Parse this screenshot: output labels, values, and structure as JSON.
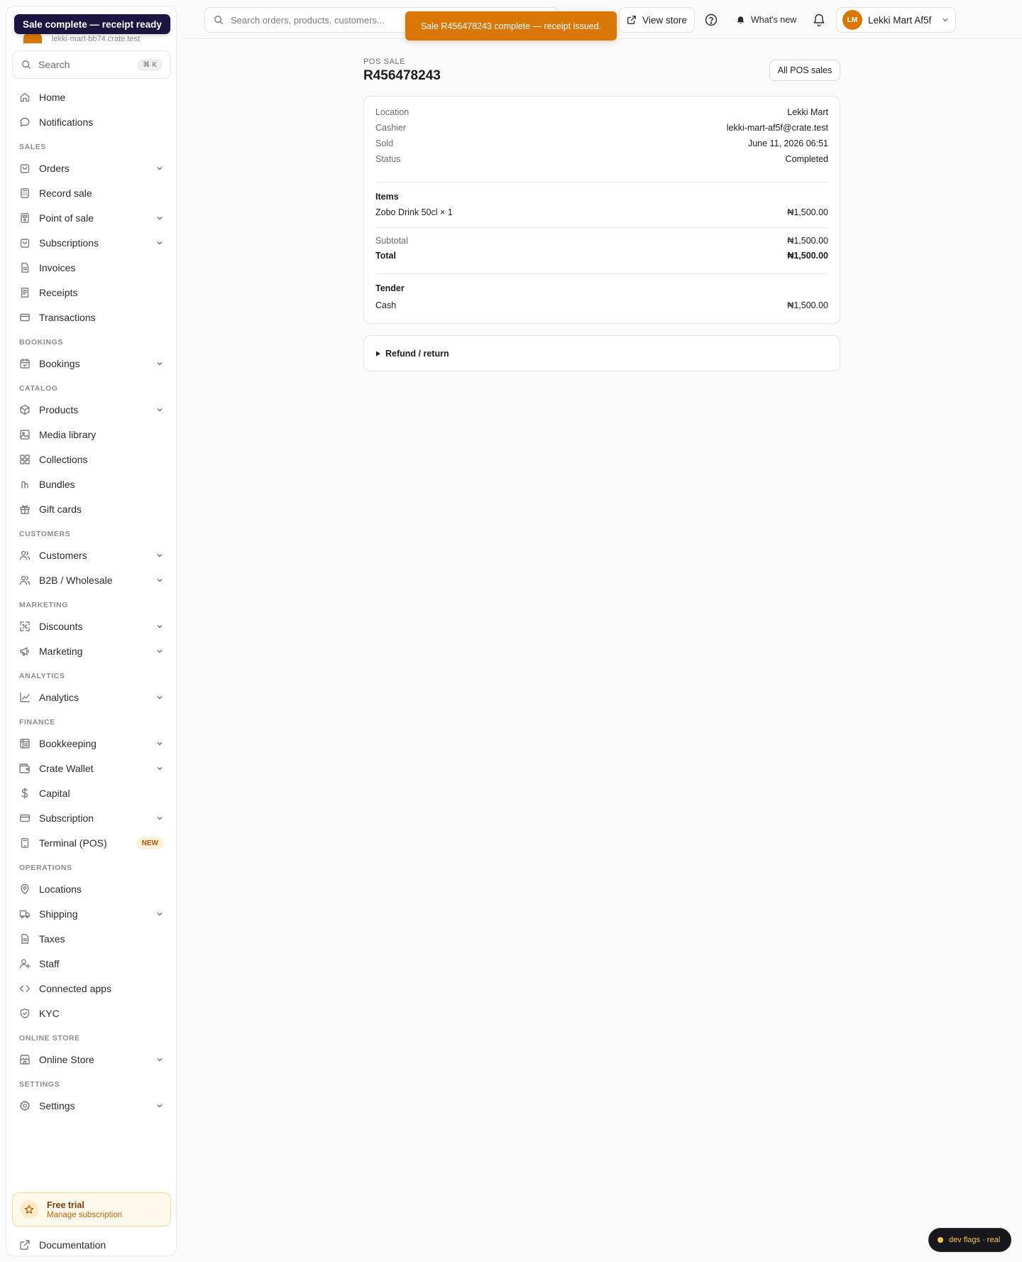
{
  "toast_left": "Sale complete — receipt ready",
  "store": {
    "email_partial": "lekki-mart-bb74.crate.test"
  },
  "sidebar": {
    "search_placeholder": "Search",
    "search_shortcut": "⌘ K",
    "top_items": [
      {
        "label": "Home",
        "icon": "home-icon"
      },
      {
        "label": "Notifications",
        "icon": "chat-bubble-icon"
      }
    ],
    "sections": [
      {
        "title": "SALES",
        "items": [
          {
            "label": "Orders",
            "icon": "bag-icon",
            "chevron": true
          },
          {
            "label": "Record sale",
            "icon": "calculator-icon",
            "chevron": false
          },
          {
            "label": "Point of sale",
            "icon": "pos-terminal-icon",
            "chevron": true
          },
          {
            "label": "Subscriptions",
            "icon": "bag-icon",
            "chevron": true
          },
          {
            "label": "Invoices",
            "icon": "document-icon",
            "chevron": false
          },
          {
            "label": "Receipts",
            "icon": "receipt-icon",
            "chevron": false
          },
          {
            "label": "Transactions",
            "icon": "credit-card-icon",
            "chevron": false
          }
        ]
      },
      {
        "title": "BOOKINGS",
        "items": [
          {
            "label": "Bookings",
            "icon": "calendar-icon",
            "chevron": true
          }
        ]
      },
      {
        "title": "CATALOG",
        "items": [
          {
            "label": "Products",
            "icon": "box-icon",
            "chevron": true
          },
          {
            "label": "Media library",
            "icon": "image-icon",
            "chevron": false
          },
          {
            "label": "Collections",
            "icon": "grid-icon",
            "chevron": false
          },
          {
            "label": "Bundles",
            "icon": "bundle-icon",
            "chevron": false
          },
          {
            "label": "Gift cards",
            "icon": "gift-icon",
            "chevron": false
          }
        ]
      },
      {
        "title": "CUSTOMERS",
        "items": [
          {
            "label": "Customers",
            "icon": "users-icon",
            "chevron": true
          },
          {
            "label": "B2B / Wholesale",
            "icon": "users-icon",
            "chevron": true
          }
        ]
      },
      {
        "title": "MARKETING",
        "items": [
          {
            "label": "Discounts",
            "icon": "discount-icon",
            "chevron": true
          },
          {
            "label": "Marketing",
            "icon": "megaphone-icon",
            "chevron": true
          }
        ]
      },
      {
        "title": "ANALYTICS",
        "items": [
          {
            "label": "Analytics",
            "icon": "chart-icon",
            "chevron": true
          }
        ]
      },
      {
        "title": "FINANCE",
        "items": [
          {
            "label": "Bookkeeping",
            "icon": "ledger-icon",
            "chevron": true
          },
          {
            "label": "Crate Wallet",
            "icon": "wallet-icon",
            "chevron": true
          },
          {
            "label": "Capital",
            "icon": "dollar-icon",
            "chevron": false
          },
          {
            "label": "Subscription",
            "icon": "credit-card-icon",
            "chevron": true
          },
          {
            "label": "Terminal (POS)",
            "icon": "terminal-icon",
            "chevron": false,
            "badge": "NEW"
          }
        ]
      },
      {
        "title": "OPERATIONS",
        "items": [
          {
            "label": "Locations",
            "icon": "pin-icon",
            "chevron": false
          },
          {
            "label": "Shipping",
            "icon": "truck-icon",
            "chevron": true
          },
          {
            "label": "Taxes",
            "icon": "document-icon",
            "chevron": false
          },
          {
            "label": "Staff",
            "icon": "user-plus-icon",
            "chevron": false
          },
          {
            "label": "Connected apps",
            "icon": "code-icon",
            "chevron": false
          },
          {
            "label": "KYC",
            "icon": "shield-icon",
            "chevron": false
          }
        ]
      },
      {
        "title": "ONLINE STORE",
        "items": [
          {
            "label": "Online Store",
            "icon": "storefront-icon",
            "chevron": true
          }
        ]
      },
      {
        "title": "SETTINGS",
        "items": [
          {
            "label": "Settings",
            "icon": "gear-icon",
            "chevron": true
          }
        ]
      }
    ],
    "trial": {
      "title": "Free trial",
      "subtitle": "Manage subscription"
    },
    "docs": "Documentation"
  },
  "topbar": {
    "search_placeholder": "Search orders, products, customers...",
    "view_store": "View store",
    "whats_new": "What's new",
    "avatar_initials": "LM",
    "account_name": "Lekki Mart Af5f"
  },
  "toast_center": "Sale R456478243 complete — receipt issued.",
  "page": {
    "eyebrow": "POS SALE",
    "title": "R456478243",
    "all_sales_button": "All POS sales",
    "details": [
      {
        "key": "Location",
        "value": "Lekki Mart"
      },
      {
        "key": "Cashier",
        "value": "lekki-mart-af5f@crate.test"
      },
      {
        "key": "Sold",
        "value": "June 11, 2026 06:51"
      },
      {
        "key": "Status",
        "value": "Completed"
      }
    ],
    "items_heading": "Items",
    "items": [
      {
        "name": "Zobo Drink 50cl × 1",
        "amount": "₦1,500.00"
      }
    ],
    "subtotal_label": "Subtotal",
    "subtotal": "₦1,500.00",
    "total_label": "Total",
    "total": "₦1,500.00",
    "tender_heading": "Tender",
    "tender": [
      {
        "method": "Cash",
        "amount": "₦1,500.00"
      }
    ],
    "refund_label": "Refund / return"
  },
  "dev_flags": "dev flags · real",
  "colors": {
    "accent": "#d97706",
    "toast_dark": "#1a1640"
  }
}
